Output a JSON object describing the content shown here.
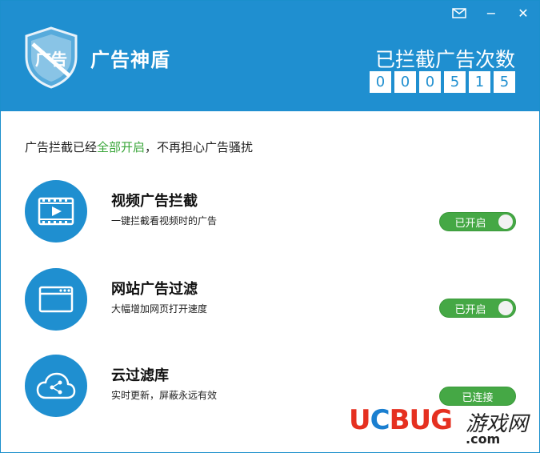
{
  "header": {
    "logo_text": "广告",
    "app_title": "广告神盾",
    "count_label": "已拦截广告次数",
    "digits": [
      "0",
      "0",
      "0",
      "5",
      "1",
      "5"
    ]
  },
  "window_controls": {
    "mail_icon": "mail-icon",
    "minimize": "−",
    "close": "✕"
  },
  "status": {
    "prefix": "广告拦截已经",
    "highlight": "全部开启",
    "suffix": "，不再担心广告骚扰",
    "highlight_color": "#3aa63a"
  },
  "features": [
    {
      "name": "视频广告拦截",
      "desc": "一键拦截看视频时的广告",
      "icon": "video-player-icon",
      "toggle": "已开启"
    },
    {
      "name": "网站广告过滤",
      "desc": "大幅增加网页打开速度",
      "icon": "browser-window-icon",
      "toggle": "已开启"
    },
    {
      "name": "云过滤库",
      "desc": "实时更新，屏蔽永远有效",
      "icon": "cloud-share-icon",
      "toggle": "已连接"
    }
  ],
  "watermark": {
    "brand_red1": "U",
    "brand_blue": "C",
    "brand_red2": "BUG",
    "cn": "游戏网",
    "domain": ".com"
  },
  "colors": {
    "accent_blue": "#1f8fd0",
    "toggle_green": "#45a845"
  }
}
